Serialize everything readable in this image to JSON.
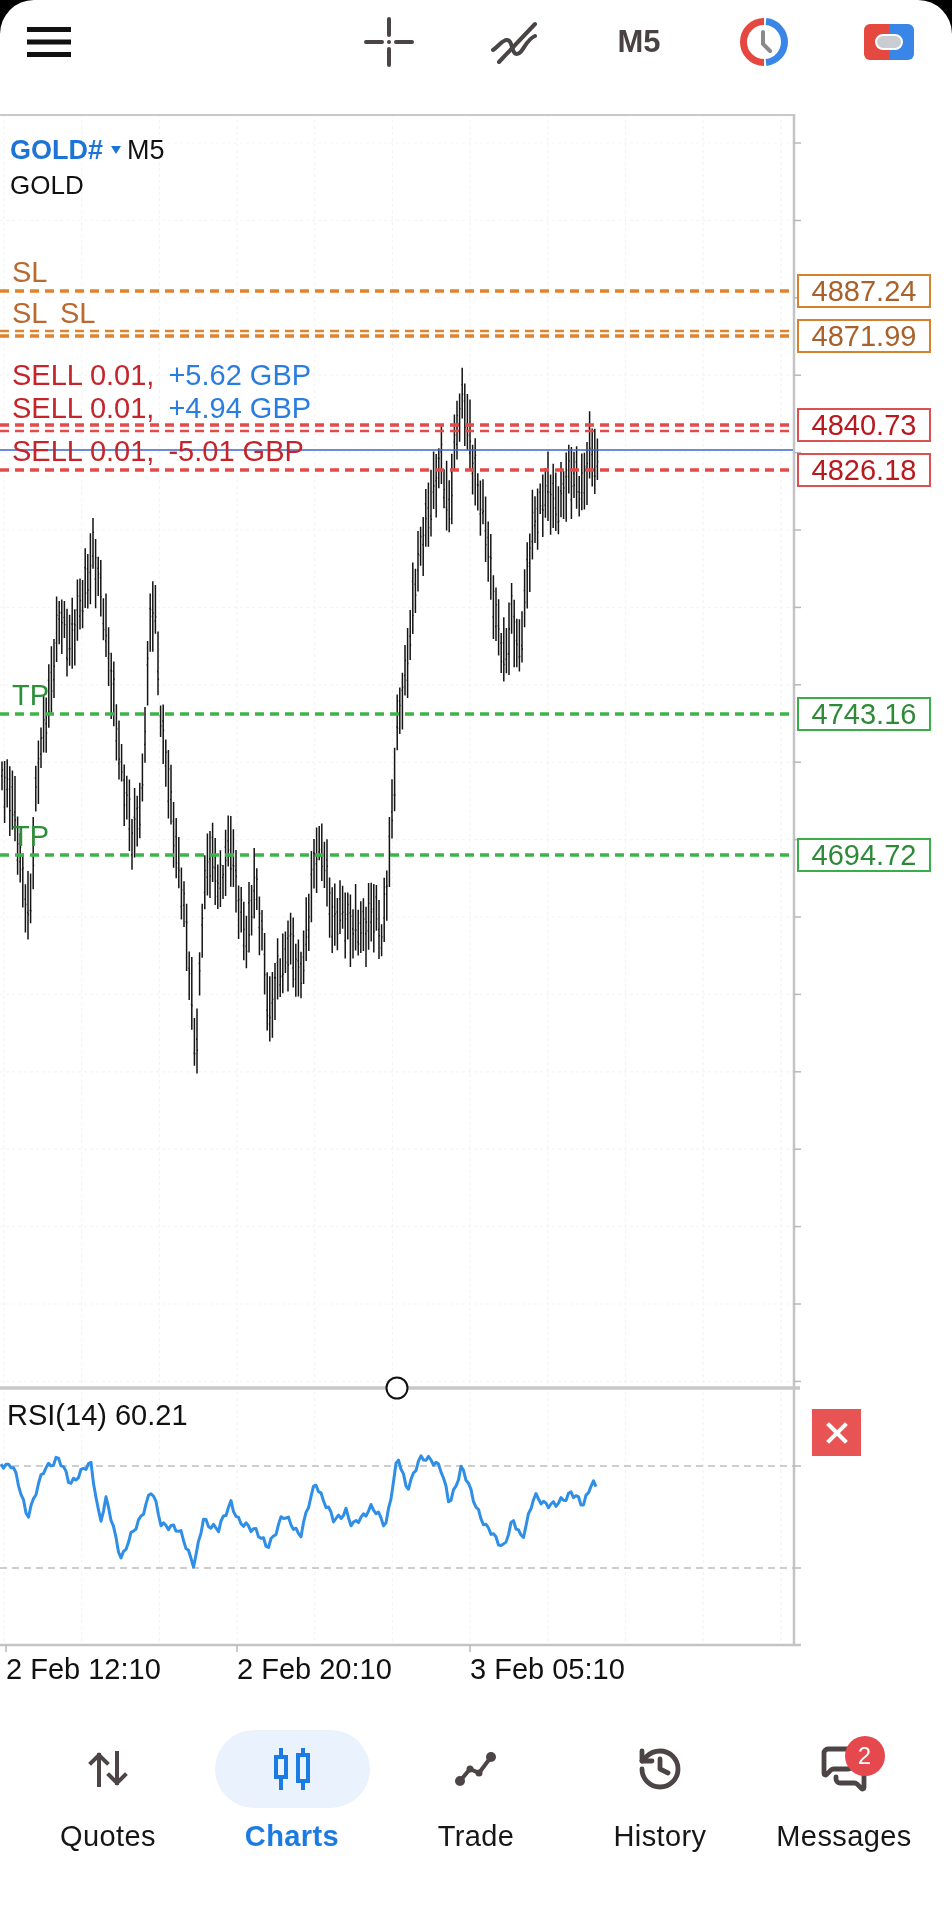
{
  "top_bar": {
    "timeframe": "M5"
  },
  "chart": {
    "symbol": "GOLD#",
    "timeframe": "M5",
    "description": "GOLD",
    "levels": [
      {
        "kind": "stop_loss",
        "label": "SL",
        "price": "4887.24"
      },
      {
        "kind": "stop_loss",
        "label": "SL",
        "price": "4871.99"
      },
      {
        "kind": "stop_loss",
        "label": "SL"
      },
      {
        "kind": "position",
        "label": "SELL 0.01,",
        "profit": "+5.62 GBP",
        "in_profit": true,
        "price": "4840.73"
      },
      {
        "kind": "position",
        "label": "SELL 0.01,",
        "profit": "+4.94 GBP",
        "in_profit": true
      },
      {
        "kind": "position",
        "label": "SELL 0.01,",
        "profit": "-5.01 GBP",
        "in_profit": false,
        "price": "4826.18"
      },
      {
        "kind": "take_profit",
        "label": "TP",
        "price": "4743.16"
      },
      {
        "kind": "take_profit",
        "label": "TP",
        "price": "4694.72"
      }
    ]
  },
  "indicator": {
    "label": "RSI(14) 60.21"
  },
  "time_axis": {
    "labels": [
      "2 Feb 12:10",
      "2 Feb 20:10",
      "3 Feb 05:10"
    ]
  },
  "bottom_nav": [
    {
      "label": "Quotes",
      "selected": false
    },
    {
      "label": "Charts",
      "selected": true
    },
    {
      "label": "Trade",
      "selected": false
    },
    {
      "label": "History",
      "selected": false
    },
    {
      "label": "Messages",
      "selected": false,
      "badge": "2"
    }
  ]
}
